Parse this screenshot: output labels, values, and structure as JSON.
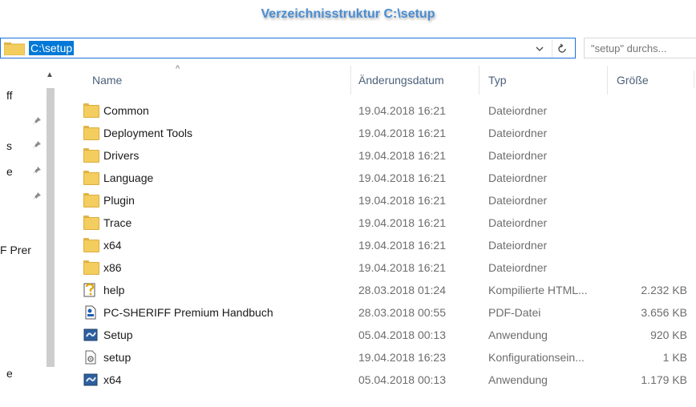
{
  "caption": "Verzeichnisstruktur C:\\setup",
  "address": {
    "path": "C:\\setup",
    "dropdown_icon": "chevron-down-icon",
    "refresh_icon": "refresh-icon"
  },
  "search": {
    "placeholder": "\"setup\" durchs..."
  },
  "nav": {
    "items": [
      {
        "label": "ff",
        "pinned": false
      },
      {
        "label": "",
        "pinned": true
      },
      {
        "label": "s",
        "pinned": true
      },
      {
        "label": "e",
        "pinned": true
      },
      {
        "label": "",
        "pinned": true
      },
      {
        "label": "F Prer",
        "pinned": false
      },
      {
        "label": "e",
        "pinned": false
      }
    ]
  },
  "columns": {
    "name": "Name",
    "date": "Änderungsdatum",
    "type": "Typ",
    "size": "Größe"
  },
  "files": [
    {
      "icon": "folder-icon",
      "name": "Common",
      "date": "19.04.2018 16:21",
      "type": "Dateiordner",
      "size": ""
    },
    {
      "icon": "folder-icon",
      "name": "Deployment Tools",
      "date": "19.04.2018 16:21",
      "type": "Dateiordner",
      "size": ""
    },
    {
      "icon": "folder-icon",
      "name": "Drivers",
      "date": "19.04.2018 16:21",
      "type": "Dateiordner",
      "size": ""
    },
    {
      "icon": "folder-icon",
      "name": "Language",
      "date": "19.04.2018 16:21",
      "type": "Dateiordner",
      "size": ""
    },
    {
      "icon": "folder-icon",
      "name": "Plugin",
      "date": "19.04.2018 16:21",
      "type": "Dateiordner",
      "size": ""
    },
    {
      "icon": "folder-icon",
      "name": "Trace",
      "date": "19.04.2018 16:21",
      "type": "Dateiordner",
      "size": ""
    },
    {
      "icon": "folder-icon",
      "name": "x64",
      "date": "19.04.2018 16:21",
      "type": "Dateiordner",
      "size": ""
    },
    {
      "icon": "folder-icon",
      "name": "x86",
      "date": "19.04.2018 16:21",
      "type": "Dateiordner",
      "size": ""
    },
    {
      "icon": "chm-help-icon",
      "name": "help",
      "date": "28.03.2018 01:24",
      "type": "Kompilierte HTML...",
      "size": "2.232 KB"
    },
    {
      "icon": "pdf-file-icon",
      "name": "PC-SHERIFF Premium Handbuch",
      "date": "28.03.2018 00:55",
      "type": "PDF-Datei",
      "size": "3.656 KB"
    },
    {
      "icon": "installer-app-icon",
      "name": "Setup",
      "date": "05.04.2018 00:13",
      "type": "Anwendung",
      "size": "920 KB"
    },
    {
      "icon": "config-file-icon",
      "name": "setup",
      "date": "19.04.2018 16:23",
      "type": "Konfigurationsein...",
      "size": "1 KB"
    },
    {
      "icon": "installer-app-icon",
      "name": "x64",
      "date": "05.04.2018 00:13",
      "type": "Anwendung",
      "size": "1.179 KB"
    }
  ],
  "colors": {
    "accent": "#0078d7",
    "caption": "#4a8ed2",
    "folder": "#f4cd5f"
  }
}
